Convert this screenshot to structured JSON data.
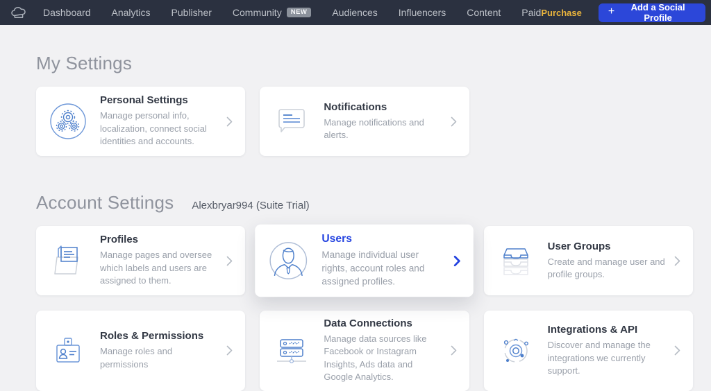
{
  "navbar": {
    "logo": "chef-hat",
    "items": [
      {
        "label": "Dashboard"
      },
      {
        "label": "Analytics"
      },
      {
        "label": "Publisher"
      },
      {
        "label": "Community",
        "badge": "NEW"
      },
      {
        "label": "Audiences"
      },
      {
        "label": "Influencers"
      },
      {
        "label": "Content"
      },
      {
        "label": "Paid"
      }
    ],
    "purchase_label": "Purchase",
    "add_profile": {
      "plus": "+",
      "label": "Add a Social Profile"
    }
  },
  "my_settings": {
    "title": "My Settings",
    "cards": [
      {
        "title": "Personal Settings",
        "description": "Manage personal info, localization, connect social identities and accounts.",
        "icon": "personal-settings-icon"
      },
      {
        "title": "Notifications",
        "description": "Manage notifications and alerts.",
        "icon": "notifications-icon"
      }
    ]
  },
  "account_settings": {
    "title": "Account Settings",
    "account_label": "Alexbryar994 (Suite Trial)",
    "cards": [
      {
        "title": "Profiles",
        "description": "Manage pages and oversee which labels and users are assigned to them.",
        "icon": "profiles-icon",
        "active": false
      },
      {
        "title": "Users",
        "description": "Manage individual user rights, account roles and assigned profiles.",
        "icon": "users-icon",
        "active": true
      },
      {
        "title": "User Groups",
        "description": "Create and manage user and profile groups.",
        "icon": "user-groups-icon",
        "active": false
      },
      {
        "title": "Roles & Permissions",
        "description": "Manage roles and permissions",
        "icon": "roles-permissions-icon",
        "active": false
      },
      {
        "title": "Data Connections",
        "description": "Manage data sources like Facebook or Instagram Insights, Ads data and Google Analytics.",
        "icon": "data-connections-icon",
        "active": false
      },
      {
        "title": "Integrations & API",
        "description": "Discover and manage the integrations we currently support.",
        "icon": "integrations-api-icon",
        "active": false
      }
    ]
  },
  "colors": {
    "navbar_bg": "#2b3140",
    "accent_blue": "#2c47d9",
    "active_text_blue": "#2443e0",
    "purchase_gold": "#e9b43d",
    "page_bg": "#f1f1f3",
    "icon_blue": "#5b87cf",
    "icon_gray": "#c9ced6"
  }
}
